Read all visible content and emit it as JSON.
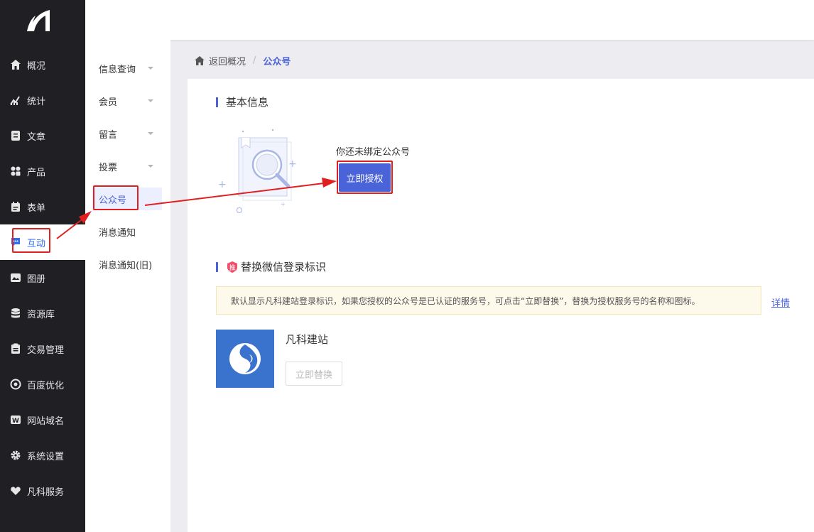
{
  "sidebar": {
    "logo_icon": "sail-logo-icon",
    "items": [
      {
        "label": "概况",
        "icon": "home-icon"
      },
      {
        "label": "统计",
        "icon": "chart-icon"
      },
      {
        "label": "文章",
        "icon": "article-icon"
      },
      {
        "label": "产品",
        "icon": "grid-icon"
      },
      {
        "label": "表单",
        "icon": "form-icon"
      },
      {
        "label": "互动",
        "icon": "chat-icon",
        "active": true
      },
      {
        "label": "图册",
        "icon": "album-icon"
      },
      {
        "label": "资源库",
        "icon": "database-icon"
      },
      {
        "label": "交易管理",
        "icon": "clipboard-icon"
      },
      {
        "label": "百度优化",
        "icon": "target-icon"
      },
      {
        "label": "网站域名",
        "icon": "w-icon"
      },
      {
        "label": "系统设置",
        "icon": "gear-icon"
      },
      {
        "label": "凡科服务",
        "icon": "heart-icon"
      }
    ]
  },
  "submenu": {
    "items": [
      {
        "label": "信息查询",
        "expandable": true
      },
      {
        "label": "会员",
        "expandable": true
      },
      {
        "label": "留言",
        "expandable": true
      },
      {
        "label": "投票",
        "expandable": true
      },
      {
        "label": "公众号",
        "active": true
      },
      {
        "label": "消息通知"
      },
      {
        "label": "消息通知(旧)"
      }
    ]
  },
  "breadcrumb": {
    "back_label": "返回概况",
    "separator": "/",
    "current": "公众号"
  },
  "basic_info": {
    "title": "基本信息",
    "unbound_text": "你还未绑定公众号",
    "auth_button": "立即授权"
  },
  "replace_section": {
    "badge": "推",
    "title": "替换微信登录标识",
    "notice": "默认显示凡科建站登录标识，如果您授权的公众号是已认证的服务号，可点击“立即替换”，替换为授权服务号的名称和图标。",
    "detail_link": "详情",
    "brand_name": "凡科建站",
    "replace_button": "立即替换"
  },
  "colors": {
    "accent": "#4a63d9",
    "sidebar_bg": "#1f1f24",
    "annotation_red": "#e02020",
    "brand_blue": "#3a73cd",
    "badge_pink": "#f0506e"
  }
}
